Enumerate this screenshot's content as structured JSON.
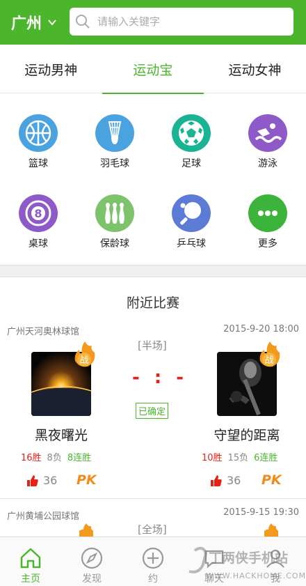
{
  "header": {
    "city": "广州",
    "search_placeholder": "请输入关键字"
  },
  "tabs": [
    {
      "label": "运动男神",
      "active": false
    },
    {
      "label": "运动宝",
      "active": true
    },
    {
      "label": "运动女神",
      "active": false
    }
  ],
  "sports": [
    {
      "label": "篮球",
      "icon": "basketball-icon",
      "color": "#4aa3df"
    },
    {
      "label": "羽毛球",
      "icon": "badminton-icon",
      "color": "#4aa3df"
    },
    {
      "label": "足球",
      "icon": "soccer-icon",
      "color": "#1ab394"
    },
    {
      "label": "游泳",
      "icon": "swimming-icon",
      "color": "#8e5ac8"
    },
    {
      "label": "桌球",
      "icon": "billiards-icon",
      "color": "#8e5ac8"
    },
    {
      "label": "保龄球",
      "icon": "bowling-icon",
      "color": "#7cc36b"
    },
    {
      "label": "乒乓球",
      "icon": "pingpong-icon",
      "color": "#5b7bd5"
    },
    {
      "label": "更多",
      "icon": "more-icon",
      "color": "#3cb43c"
    }
  ],
  "nearby": {
    "title": "附近比赛",
    "matches": [
      {
        "venue": "广州天河奥林球馆",
        "datetime": "2015-9-20   18:00",
        "type": "[半场]",
        "score": "- : -",
        "status": "已确定",
        "badge": "战",
        "home": {
          "name": "黑夜曙光",
          "wins": "16胜",
          "losses": "8负",
          "streak": "8连胜",
          "likes": "36",
          "pk": "PK"
        },
        "away": {
          "name": "守望的距离",
          "wins": "10胜",
          "losses": "15负",
          "streak": "6连胜",
          "likes": "36",
          "pk": "PK"
        }
      },
      {
        "venue": "广州黄埔公园球馆",
        "datetime": "2015-9-15   19:30",
        "type": "[全场]"
      }
    ]
  },
  "bottom_nav": [
    {
      "label": "主页",
      "icon": "home-icon",
      "active": true
    },
    {
      "label": "发现",
      "icon": "compass-icon",
      "active": false
    },
    {
      "label": "约",
      "icon": "plus-circle-icon",
      "active": false
    },
    {
      "label": "聊天",
      "icon": "chat-icon",
      "active": false
    },
    {
      "label": "我",
      "icon": "user-icon",
      "active": false
    }
  ],
  "watermark": {
    "line1": "丁两侠手机站",
    "line2": "WWW.HACKHOME.COM"
  },
  "colors": {
    "brand": "#4bb52c",
    "win": "#e2231a",
    "pk": "#f08c1e"
  }
}
